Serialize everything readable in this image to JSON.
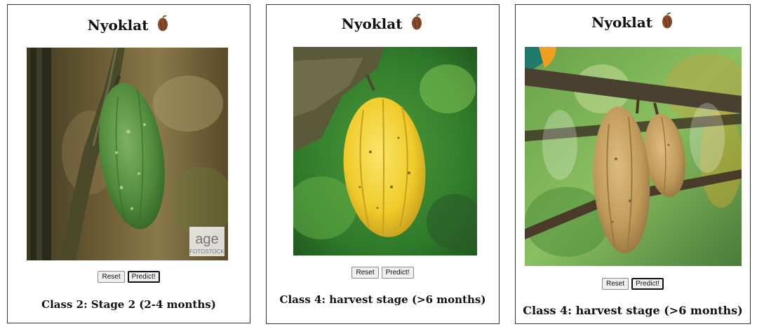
{
  "panels": [
    {
      "title": "Nyoklat",
      "title_icon": "cocoa-pod-icon",
      "reset_label": "Reset",
      "predict_label": "Predict!",
      "result": "Class 2: Stage 2 (2-4 months)",
      "watermark_logo": "age",
      "watermark_brand": "FOTOSTOCK"
    },
    {
      "title": "Nyoklat",
      "title_icon": "cocoa-pod-icon",
      "reset_label": "Reset",
      "predict_label": "Predict!",
      "result": "Class 4: harvest stage (>6 months)"
    },
    {
      "title": "Nyoklat",
      "title_icon": "cocoa-pod-icon",
      "reset_label": "Reset",
      "predict_label": "Predict!",
      "result": "Class 4: harvest stage (>6 months)"
    }
  ],
  "colors": {
    "border": "#333333",
    "pod_icon": "#8a4b2b",
    "pod_green": "#5e9447",
    "pod_yellow": "#f2cf2c",
    "pod_tan": "#c8a56c"
  }
}
